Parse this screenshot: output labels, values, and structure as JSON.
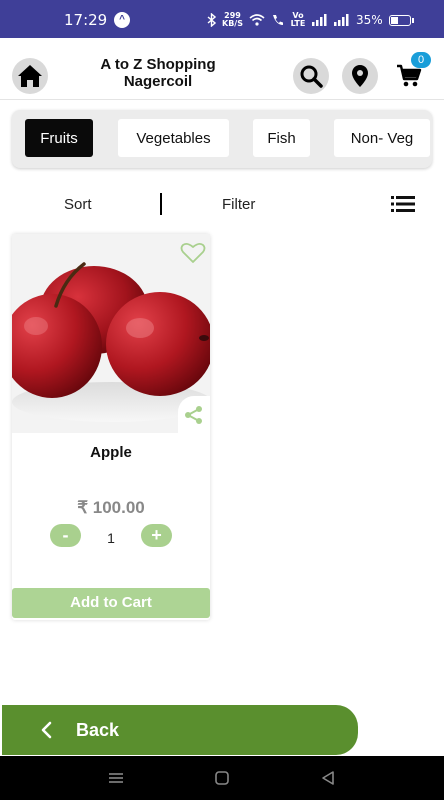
{
  "status_bar": {
    "time": "17:29",
    "net_speed_value": "299",
    "net_speed_unit": "KB/S",
    "volte_label": "Vo LTE",
    "battery_percent": "35%",
    "battery_level": 0.35,
    "bar_color": "#3f3f98"
  },
  "header": {
    "title_line1": "A to Z Shopping",
    "title_line2": "Nagercoil",
    "cart_count": "0",
    "badge_color": "#1a9ed9",
    "icons": [
      "home-icon",
      "search-icon",
      "location-pin-icon",
      "cart-icon"
    ]
  },
  "categories": [
    {
      "label": "Fruits",
      "active": true
    },
    {
      "label": "Vegetables",
      "active": false
    },
    {
      "label": "Fish",
      "active": false
    },
    {
      "label": "Non- Veg",
      "active": false
    }
  ],
  "toolbar": {
    "sort_label": "Sort",
    "filter_label": "Filter",
    "view_icon": "list-view-icon"
  },
  "products": [
    {
      "name": "Apple",
      "price": "₹ 100.00",
      "quantity": "1",
      "minus_label": "-",
      "plus_label": "+",
      "add_to_cart_label": "Add to Cart",
      "favorite_icon": "heart-outline-icon",
      "share_icon": "share-icon",
      "accent_color": "#a9d08e"
    }
  ],
  "footer": {
    "back_label": "Back",
    "back_color": "#5a8f2e"
  }
}
